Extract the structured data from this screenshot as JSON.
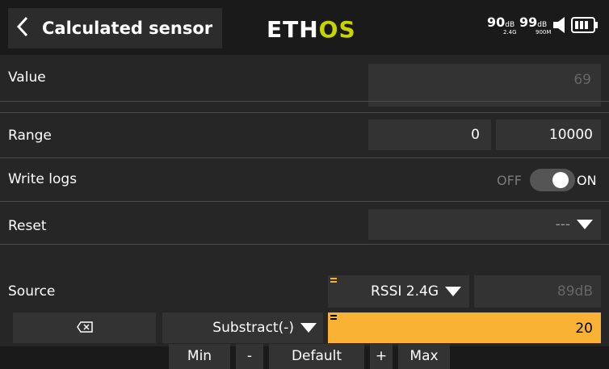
{
  "header": {
    "back_icon": "chevron-left-icon",
    "title": "Calculated sensor",
    "logo_eth": "ETH",
    "logo_os": "OS",
    "rssi1": {
      "value": "90",
      "unit": "dB",
      "band": "2.4G"
    },
    "rssi2": {
      "value": "99",
      "unit": "dB",
      "band": "900M"
    },
    "volume_icon": "speaker-icon",
    "battery_icon": "battery-icon"
  },
  "rows": {
    "value": {
      "label": "Value",
      "value": "69"
    },
    "range": {
      "label": "Range",
      "min": "0",
      "separator": "-",
      "max": "10000"
    },
    "write_logs": {
      "label": "Write logs",
      "off": "OFF",
      "on": "ON",
      "state": "on"
    },
    "reset": {
      "label": "Reset",
      "value": "---"
    },
    "source": {
      "label": "Source",
      "sensor": "RSSI 2.4G",
      "reading": "89dB"
    },
    "operation": {
      "delete_icon": "backspace-icon",
      "operator": "Substract(-)",
      "amount": "20"
    }
  },
  "bottom": {
    "min": "Min",
    "minus": "-",
    "default": "Default",
    "plus": "+",
    "max": "Max"
  },
  "colors": {
    "accent": "#f9b234",
    "logo_os": "#c8d400"
  }
}
